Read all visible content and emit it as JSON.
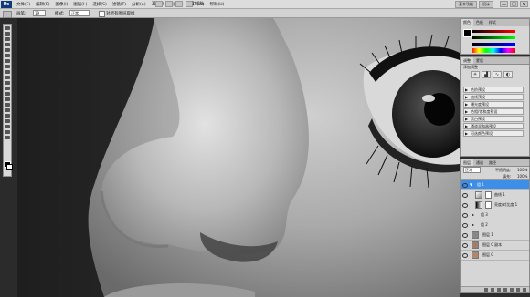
{
  "app": {
    "logo_text": "Ps",
    "menu": [
      "文件(F)",
      "编辑(E)",
      "图像(I)",
      "图层(L)",
      "选择(S)",
      "滤镜(T)",
      "分析(A)",
      "3D(D)",
      "视图(V)",
      "窗口(W)",
      "帮助(H)"
    ],
    "zoom": "100%",
    "workspace_tabs": [
      "基本功能",
      "设计"
    ],
    "window_buttons": [
      "—",
      "□",
      "✕"
    ]
  },
  "options": {
    "size_label": "画笔:",
    "size_value": "19",
    "mode_label": "模式:",
    "mode_value": "正常",
    "sample_label": "对所有图层取样"
  },
  "panels": {
    "color": {
      "tabs": [
        "颜色",
        "色板",
        "样式"
      ]
    },
    "adjust": {
      "tabs": [
        "调整",
        "蒙版"
      ],
      "title": "添加调整",
      "list": [
        "色阶预设",
        "曲线预设",
        "曝光度预设",
        "色相/饱和度预设",
        "黑白预设",
        "通道混和器预设",
        "可选颜色预设"
      ]
    },
    "layers": {
      "tabs": [
        "图层",
        "通道",
        "路径"
      ],
      "blend": "正常",
      "opacity_label": "不透明度:",
      "opacity": "100%",
      "fill_label": "填充:",
      "fill": "100%",
      "rows": [
        {
          "name": "组 1",
          "selected": true
        },
        {
          "name": "曲线 1",
          "selected": false
        },
        {
          "name": "亮度/对比度 1",
          "selected": false
        },
        {
          "name": "组 3",
          "selected": false
        },
        {
          "name": "组 2",
          "selected": false
        },
        {
          "name": "图层 1",
          "selected": false
        },
        {
          "name": "图层 0 副本",
          "selected": false
        },
        {
          "name": "图层 0",
          "selected": false
        }
      ]
    }
  },
  "colors": {
    "menubar": "#dcdcdc",
    "panel": "#d6d6d6",
    "selected_layer": "#3d8ee8",
    "canvas_dark": "#2b2b2b"
  }
}
